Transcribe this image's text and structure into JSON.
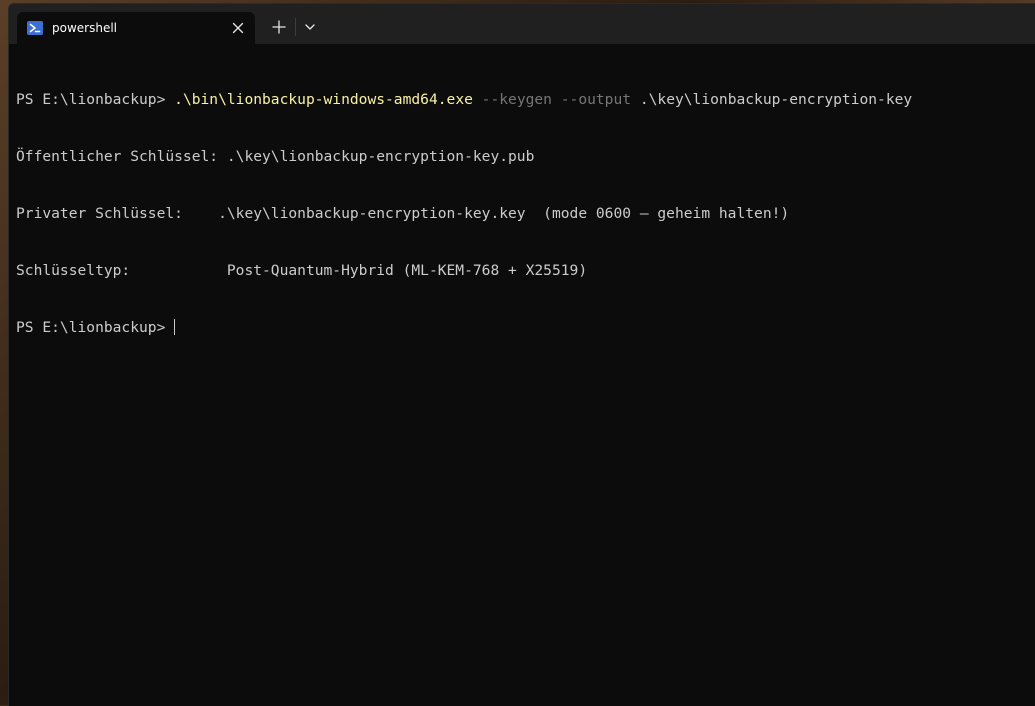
{
  "tab": {
    "title": "powershell",
    "icon": "powershell-icon"
  },
  "terminal": {
    "prompt_1": "PS E:\\lionbackup> ",
    "cmd_exe": ".\\bin\\lionbackup-windows-amd64.exe",
    "cmd_flag_1": " --keygen",
    "cmd_flag_2": " --output",
    "cmd_arg": " .\\key\\lionbackup-encryption-key",
    "out_1": "Öffentlicher Schlüssel: .\\key\\lionbackup-encryption-key.pub",
    "out_2": "Privater Schlüssel:    .\\key\\lionbackup-encryption-key.key  (mode 0600 – geheim halten!)",
    "out_3": "Schlüsseltyp:           Post-Quantum-Hybrid (ML-KEM-768 + X25519)",
    "prompt_2": "PS E:\\lionbackup> "
  },
  "colors": {
    "terminal_bg": "#0c0c0c",
    "titlebar_bg": "#202020",
    "text": "#cccccc",
    "command": "#f9f1a5",
    "flag": "#767676"
  }
}
